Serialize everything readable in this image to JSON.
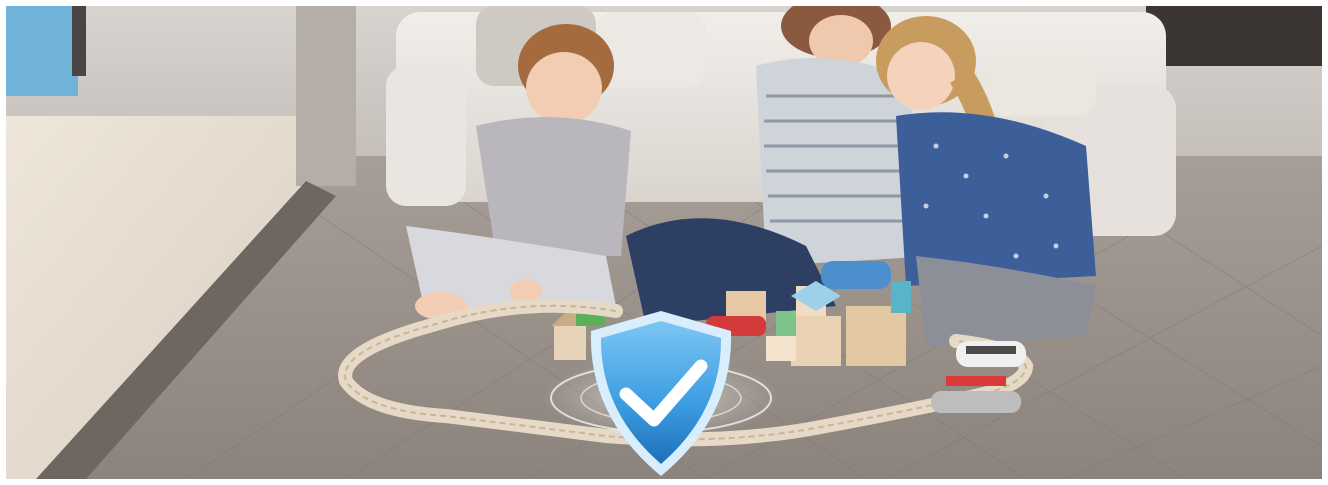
{
  "image": {
    "scene": "family-playing-on-floor",
    "overlay_icon": "shield-check-icon",
    "colors": {
      "floor_light": "#b9b2aa",
      "floor_dark": "#8f8780",
      "sofa": "#e8e4df",
      "shield_blue": "#3a9be0",
      "shield_edge": "#d8eefc",
      "track_wood": "#e6d9c6",
      "window_glass": "#6fb4d8"
    }
  }
}
